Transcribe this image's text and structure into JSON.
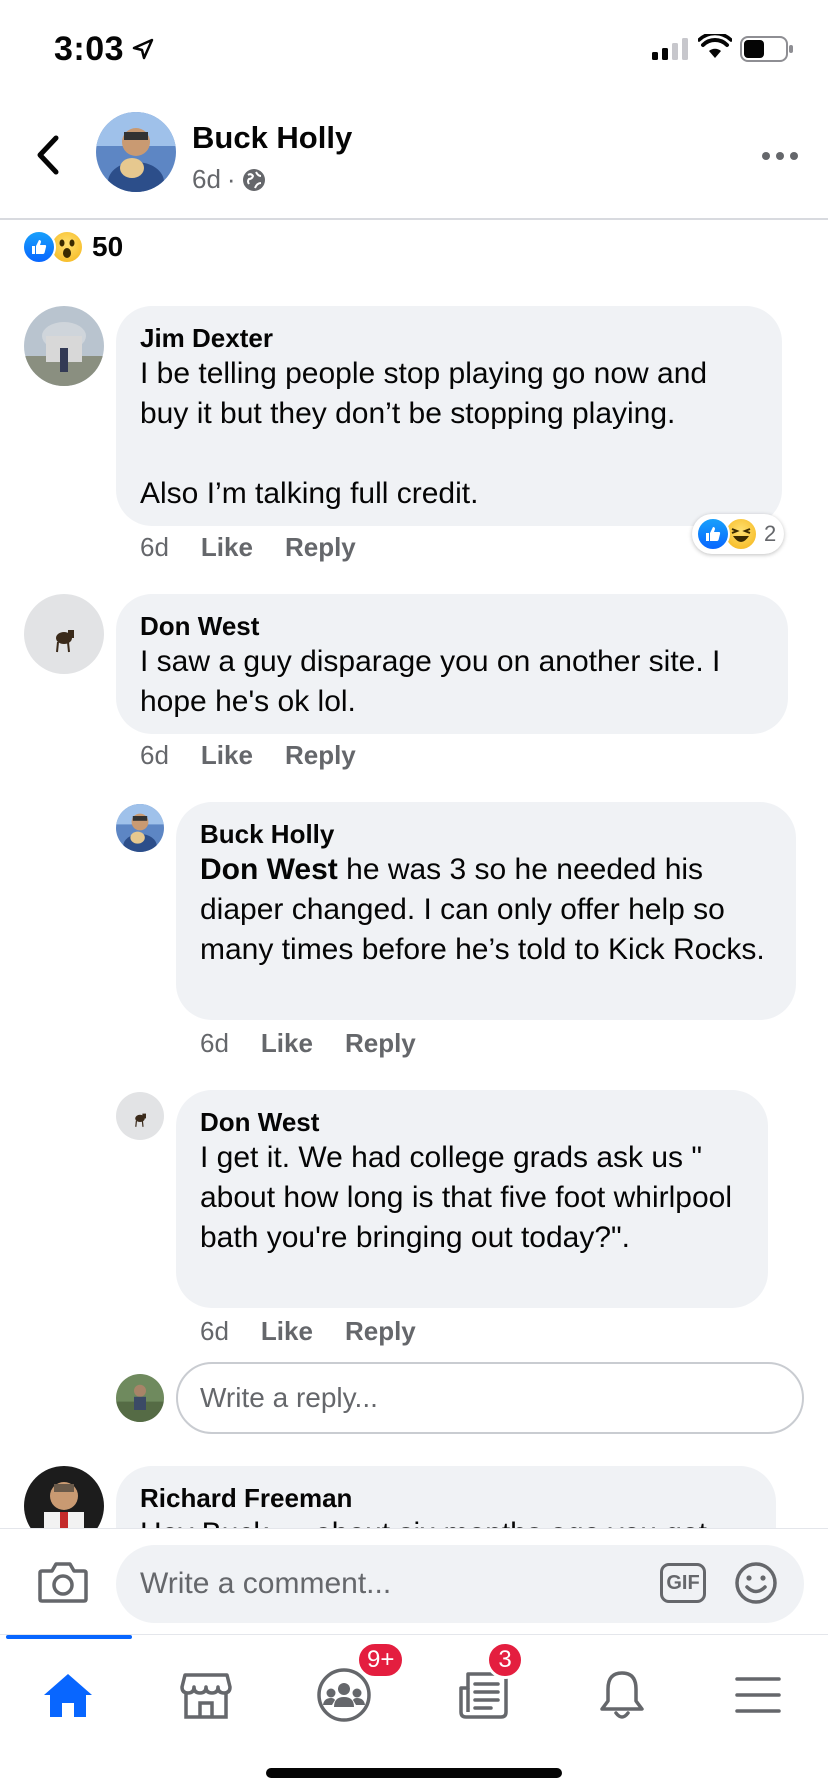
{
  "status_bar": {
    "time": "3:03"
  },
  "header": {
    "name": "Buck Holly",
    "time": "6d",
    "separator": "·"
  },
  "post": {
    "reaction_count": "50"
  },
  "comments": [
    {
      "name": "Jim Dexter",
      "text": "I be telling people stop playing go now and buy it but they don’t be stopping playing.\n\nAlso I’m talking full credit.",
      "time": "6d",
      "like": "Like",
      "reply": "Reply",
      "reaction_count": "2"
    },
    {
      "name": "Don West",
      "text": "I saw a guy disparage you on another site. I hope he's ok lol.",
      "time": "6d",
      "like": "Like",
      "reply": "Reply"
    },
    {
      "name": "Buck Holly",
      "mention": "Don West",
      "text": " he was 3 so he needed his diaper changed. I can only offer help so many times before he’s told to Kick Rocks.",
      "time": "6d",
      "like": "Like",
      "reply": "Reply"
    },
    {
      "name": "Don West",
      "text": "I get it. We had college grads ask us \" about how long is that five foot whirlpool bath you're bringing out today?\".",
      "time": "6d",
      "like": "Like",
      "reply": "Reply"
    },
    {
      "name": "Richard Freeman",
      "text": "Hey Buck … about six months ago you got"
    }
  ],
  "reply_input": {
    "placeholder": "Write a reply..."
  },
  "composer": {
    "placeholder": "Write a comment...",
    "gif_label": "GIF"
  },
  "tabbar": {
    "groups_badge": "9+",
    "news_badge": "3"
  },
  "colors": {
    "accent": "#0866ff",
    "badge": "#e41e3f",
    "bubble": "#f0f2f5",
    "muted": "#65676b"
  }
}
